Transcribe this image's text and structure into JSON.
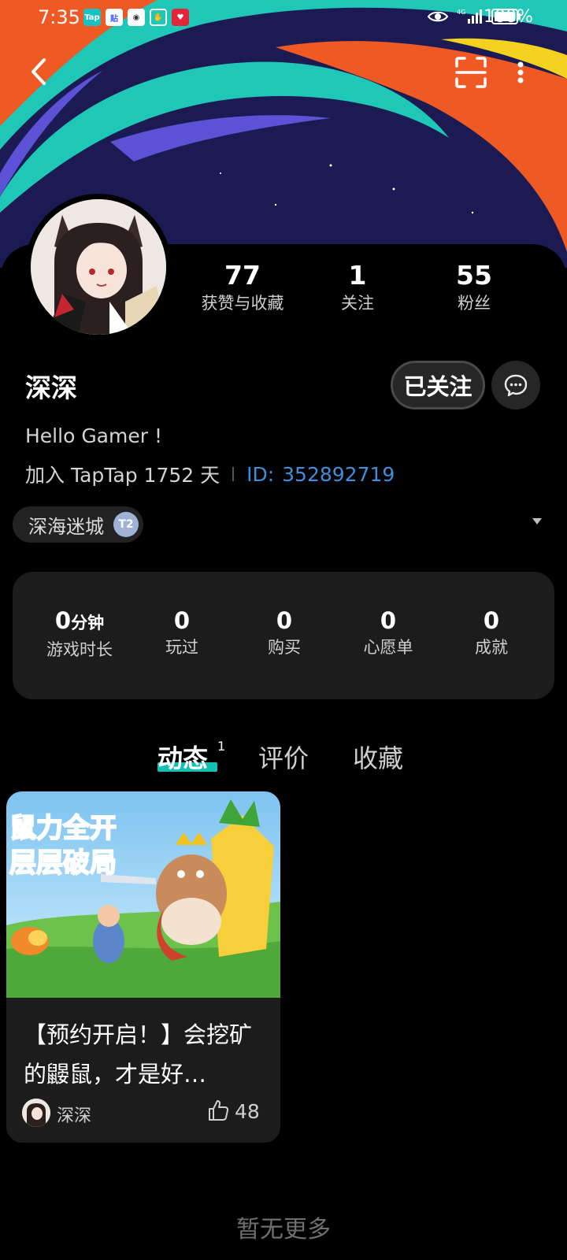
{
  "status_bar": {
    "time": "7:35",
    "battery": "100%",
    "network": "4G",
    "notification_icons": [
      "TapTap",
      "贴吧",
      "kuaishou",
      "hand",
      "heart-app"
    ]
  },
  "header": {
    "back_icon": "chevron-left-icon",
    "scan_icon": "scan-icon",
    "more_icon": "more-vertical-icon"
  },
  "profile": {
    "stats": [
      {
        "value": "77",
        "label": "获赞与收藏"
      },
      {
        "value": "1",
        "label": "关注"
      },
      {
        "value": "55",
        "label": "粉丝"
      }
    ],
    "name": "深深",
    "follow_label": "已关注",
    "bio": "Hello Gamer !",
    "join_text": "加入 TapTap 1752 天",
    "id_label": "ID:",
    "id_value": "352892719",
    "game_tag": "深海迷城",
    "game_badge": "T2"
  },
  "game_stats": [
    {
      "value": "0",
      "unit": "分钟",
      "label": "游戏时长"
    },
    {
      "value": "0",
      "unit": "",
      "label": "玩过"
    },
    {
      "value": "0",
      "unit": "",
      "label": "购买"
    },
    {
      "value": "0",
      "unit": "",
      "label": "心愿单"
    },
    {
      "value": "0",
      "unit": "",
      "label": "成就"
    }
  ],
  "tabs": [
    {
      "label": "动态",
      "badge": "1",
      "active": true
    },
    {
      "label": "评价",
      "active": false
    },
    {
      "label": "收藏",
      "active": false
    }
  ],
  "post": {
    "image_text_line1": "鼠力全开",
    "image_text_line2": "层层破局",
    "title": "【预约开启！】会挖矿的鼹鼠，才是好…",
    "author": "深深",
    "likes": "48"
  },
  "footer": {
    "no_more": "暂无更多"
  },
  "colors": {
    "accent_teal": "#14c0b2",
    "id_blue": "#3e8fdb",
    "banner_orange": "#ef5a24",
    "banner_teal": "#1fc7b6",
    "banner_purple": "#5b52d6",
    "banner_navy": "#1b1a52"
  }
}
